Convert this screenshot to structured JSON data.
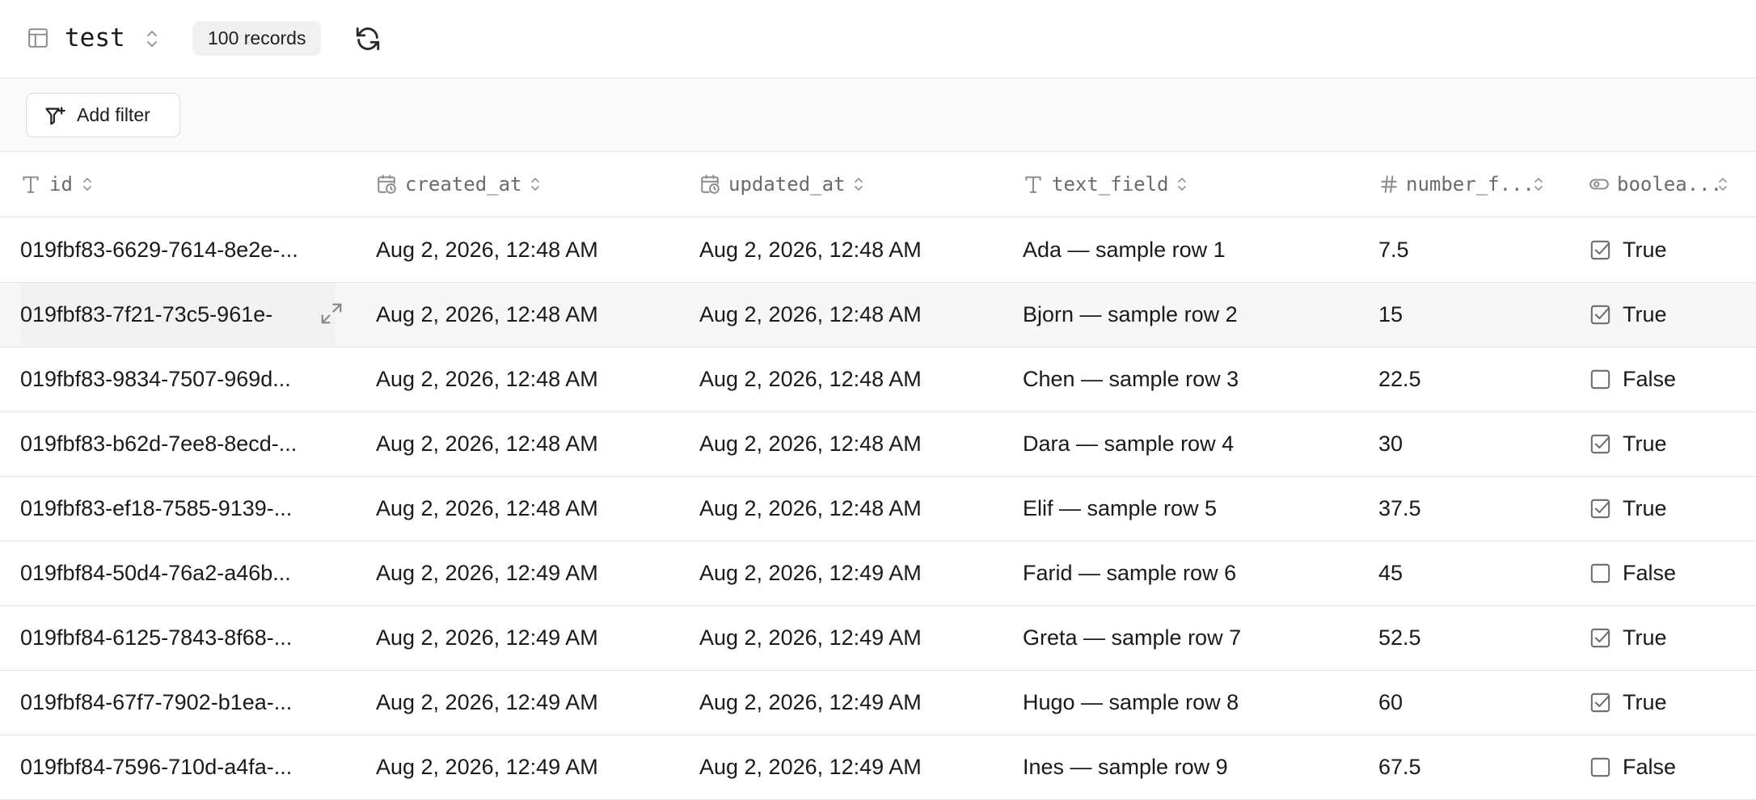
{
  "toolbar": {
    "table_name": "test",
    "records_badge": "100 records",
    "icons": [
      "table-icon",
      "chevron-updown-icon",
      "refresh-icon"
    ]
  },
  "filter_bar": {
    "add_filter_label": "Add filter",
    "icon": "filter-plus-icon"
  },
  "columns": [
    {
      "label": "id",
      "icon": "text-type-icon"
    },
    {
      "label": "created_at",
      "icon": "calendar-clock-icon"
    },
    {
      "label": "updated_at",
      "icon": "calendar-clock-icon"
    },
    {
      "label": "text_field",
      "icon": "text-type-icon"
    },
    {
      "label": "number_f...",
      "icon": "hash-icon"
    },
    {
      "label": "boolea...",
      "icon": "toggle-icon"
    }
  ],
  "rows": [
    {
      "id": "019fbf83-6629-7614-8e2e-...",
      "created_at": "Aug 2, 2026, 12:48 AM",
      "updated_at": "Aug 2, 2026, 12:48 AM",
      "text_field": "Ada — sample row 1",
      "number_field": "7.5",
      "boolean_field": "True",
      "checked": true
    },
    {
      "id": "019fbf83-7f21-73c5-961e-",
      "created_at": "Aug 2, 2026, 12:48 AM",
      "updated_at": "Aug 2, 2026, 12:48 AM",
      "text_field": "Bjorn — sample row 2",
      "number_field": "15",
      "boolean_field": "True",
      "checked": true
    },
    {
      "id": "019fbf83-9834-7507-969d...",
      "created_at": "Aug 2, 2026, 12:48 AM",
      "updated_at": "Aug 2, 2026, 12:48 AM",
      "text_field": "Chen — sample row 3",
      "number_field": "22.5",
      "boolean_field": "False",
      "checked": false
    },
    {
      "id": "019fbf83-b62d-7ee8-8ecd-...",
      "created_at": "Aug 2, 2026, 12:48 AM",
      "updated_at": "Aug 2, 2026, 12:48 AM",
      "text_field": "Dara — sample row 4",
      "number_field": "30",
      "boolean_field": "True",
      "checked": true
    },
    {
      "id": "019fbf83-ef18-7585-9139-...",
      "created_at": "Aug 2, 2026, 12:48 AM",
      "updated_at": "Aug 2, 2026, 12:48 AM",
      "text_field": "Elif — sample row 5",
      "number_field": "37.5",
      "boolean_field": "True",
      "checked": true
    },
    {
      "id": "019fbf84-50d4-76a2-a46b...",
      "created_at": "Aug 2, 2026, 12:49 AM",
      "updated_at": "Aug 2, 2026, 12:49 AM",
      "text_field": "Farid — sample row 6",
      "number_field": "45",
      "boolean_field": "False",
      "checked": false
    },
    {
      "id": "019fbf84-6125-7843-8f68-...",
      "created_at": "Aug 2, 2026, 12:49 AM",
      "updated_at": "Aug 2, 2026, 12:49 AM",
      "text_field": "Greta — sample row 7",
      "number_field": "52.5",
      "boolean_field": "True",
      "checked": true
    },
    {
      "id": "019fbf84-67f7-7902-b1ea-...",
      "created_at": "Aug 2, 2026, 12:49 AM",
      "updated_at": "Aug 2, 2026, 12:49 AM",
      "text_field": "Hugo — sample row 8",
      "number_field": "60",
      "boolean_field": "True",
      "checked": true
    },
    {
      "id": "019fbf84-7596-710d-a4fa-...",
      "created_at": "Aug 2, 2026, 12:49 AM",
      "updated_at": "Aug 2, 2026, 12:49 AM",
      "text_field": "Ines — sample row 9",
      "number_field": "67.5",
      "boolean_field": "False",
      "checked": false
    }
  ],
  "colors": {
    "border": "#e3e3e3",
    "muted_text": "#6b6b6b",
    "badge_bg": "#f0f0f0",
    "filter_bar_bg": "#fafafa",
    "hover_row_bg": "#f7f7f7"
  }
}
